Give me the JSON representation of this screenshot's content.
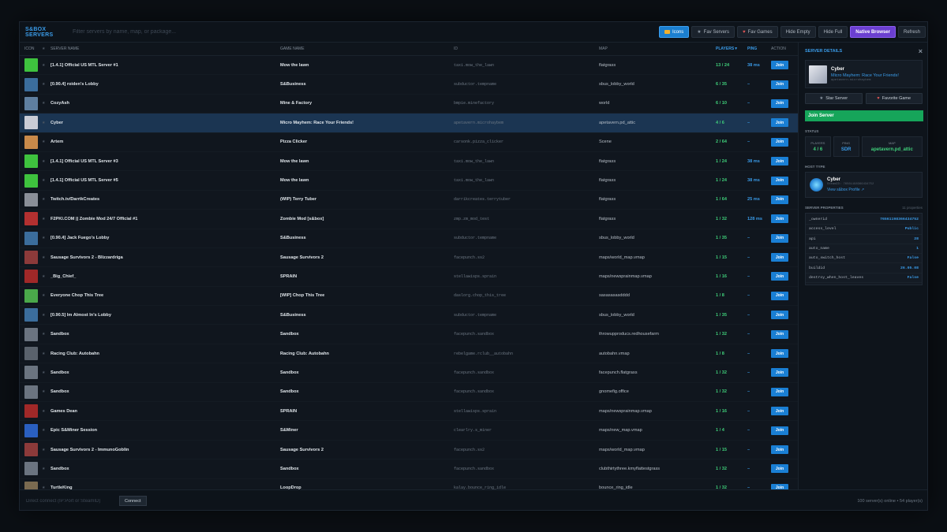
{
  "header": {
    "brand": "S&BOX SERVERS",
    "search_placeholder": "Filter servers by name, map, or package...",
    "buttons": {
      "icons": "Icons",
      "fav_servers": "Fav Servers",
      "fav_games": "Fav Games",
      "hide_empty": "Hide Empty",
      "hide_full": "Hide Full",
      "native_browser": "Native Browser",
      "refresh": "Refresh"
    }
  },
  "table": {
    "columns": {
      "icon": "ICON",
      "fav": "★",
      "server_name": "SERVER NAME",
      "game_name": "GAME NAME",
      "id": "ID",
      "map": "MAP",
      "players": "PLAYERS▼",
      "ping": "PING",
      "action": "ACTION"
    },
    "join_label": "Join",
    "rows": [
      {
        "name": "[1.4.1] Official US MTL Server #1",
        "game": "Mow the lawn",
        "id": "taxi.mow_the_lawn",
        "map": "flatgrass",
        "players": "13 / 24",
        "ping": "38 ms",
        "color": "#3ec23e"
      },
      {
        "name": "[0.90.4] roiden's Lobby",
        "game": "S&Business",
        "id": "subductor.tempname",
        "map": "sbus_lobby_world",
        "players": "6 / 35",
        "ping": "–",
        "color": "#3b6d9c"
      },
      {
        "name": "CozyAsh",
        "game": "Mine & Factory",
        "id": "bmpie.minefactory",
        "map": "world",
        "players": "6 / 10",
        "ping": "–",
        "color": "#5f7fa0"
      },
      {
        "name": "Cyber",
        "game": "Micro Mayhem: Race Your Friends!",
        "id": "apetavern.microhaybem",
        "map": "apetavern.pd_attic",
        "players": "4 / 6",
        "ping": "–",
        "color": "#c9ccd6"
      },
      {
        "name": "Artem",
        "game": "Pizza Clicker",
        "id": "carsonk.pizza_clicker",
        "map": "Scene",
        "players": "2 / 64",
        "ping": "–",
        "color": "#c98a4a"
      },
      {
        "name": "[1.4.1] Official US MTL Server #3",
        "game": "Mow the lawn",
        "id": "taxi.mow_the_lawn",
        "map": "flatgrass",
        "players": "1 / 24",
        "ping": "38 ms",
        "color": "#3ec23e"
      },
      {
        "name": "[1.4.1] Official US MTL Server #5",
        "game": "Mow the lawn",
        "id": "taxi.mow_the_lawn",
        "map": "flatgrass",
        "players": "1 / 24",
        "ping": "38 ms",
        "color": "#3ec23e"
      },
      {
        "name": "Twitch.tv/DarrikCreates",
        "game": "(WIP) Terry Tuber",
        "id": "darrikcreates.terrytuber",
        "map": "flatgrass",
        "players": "1 / 64",
        "ping": "25 ms",
        "color": "#8a8f98"
      },
      {
        "name": "F2PKI.COM || Zombie Mod 24/7 Official #1",
        "game": "Zombie Mod [s&box]",
        "id": "zmp.zm_mod_test",
        "map": "flatgrass",
        "players": "1 / 32",
        "ping": "128 ms",
        "color": "#b33030"
      },
      {
        "name": "[0.90.4] Jack Fuego's Lobby",
        "game": "S&Business",
        "id": "subductor.tempname",
        "map": "sbus_lobby_world",
        "players": "1 / 35",
        "ping": "–",
        "color": "#3b6d9c"
      },
      {
        "name": "Sausage Survivors 2 - Blizzardriga",
        "game": "Sausage Survivors 2",
        "id": "facepunch.ss2",
        "map": "maps/world_map.vmap",
        "players": "1 / 15",
        "ping": "–",
        "color": "#8c3a3a"
      },
      {
        "name": "_Big_Chief_",
        "game": "SPRAIN",
        "id": "stellawisps.sprain",
        "map": "maps/newsprainmap.vmap",
        "players": "1 / 16",
        "ping": "–",
        "color": "#a02828"
      },
      {
        "name": "Everyone Chop This Tree",
        "game": "[WIP] Chop This Tree",
        "id": "daslorg.chop_this_tree",
        "map": "sasasasasdddd",
        "players": "1 / 8",
        "ping": "–",
        "color": "#4aa84a"
      },
      {
        "name": "[0.90.5] Im Almost In's Lobby",
        "game": "S&Business",
        "id": "subductor.tempname",
        "map": "sbus_lobby_world",
        "players": "1 / 35",
        "ping": "–",
        "color": "#3b6d9c"
      },
      {
        "name": "Sandbox",
        "game": "Sandbox",
        "id": "facepunch.sandbox",
        "map": "throwupproducs.redhousefarm",
        "players": "1 / 32",
        "ping": "–",
        "color": "#6b7480"
      },
      {
        "name": "Racing Club: Autobahn",
        "game": "Racing Club: Autobahn",
        "id": "rebelgame.rclub__autobahn",
        "map": "autobahn.vmap",
        "players": "1 / 8",
        "ping": "–",
        "color": "#5a626c"
      },
      {
        "name": "Sandbox",
        "game": "Sandbox",
        "id": "facepunch.sandbox",
        "map": "facepunch.flatgrass",
        "players": "1 / 32",
        "ping": "–",
        "color": "#6b7480"
      },
      {
        "name": "Sandbox",
        "game": "Sandbox",
        "id": "facepunch.sandbox",
        "map": "gnomefig.office",
        "players": "1 / 32",
        "ping": "–",
        "color": "#6b7480"
      },
      {
        "name": "Games Dean",
        "game": "SPRAIN",
        "id": "stellawisps.sprain",
        "map": "maps/newsprainmap.vmap",
        "players": "1 / 16",
        "ping": "–",
        "color": "#a02828"
      },
      {
        "name": "Epic S&Miner Session",
        "game": "S&Miner",
        "id": "clearlry.s_miner",
        "map": "maps/new_map.vmap",
        "players": "1 / 4",
        "ping": "–",
        "color": "#2a5fc0"
      },
      {
        "name": "Sausage Survivors 2 - ImmunoGoblin",
        "game": "Sausage Survivors 2",
        "id": "facepunch.ss2",
        "map": "maps/world_map.vmap",
        "players": "1 / 15",
        "ping": "–",
        "color": "#8c3a3a"
      },
      {
        "name": "Sandbox",
        "game": "Sandbox",
        "id": "facepunch.sandbox",
        "map": "clubthirtythree.kmyflattestgrass",
        "players": "1 / 32",
        "ping": "–",
        "color": "#6b7480"
      },
      {
        "name": "TurtleKing",
        "game": "LoopDrop",
        "id": "kalay.bounce_ring_idle",
        "map": "bounce_ring_idle",
        "players": "1 / 32",
        "ping": "–",
        "color": "#7a6a50"
      }
    ]
  },
  "details": {
    "title": "SERVER DETAILS",
    "server_name": "Cyber",
    "game_name": "Micro Mayhem: Race Your Friends!",
    "game_id": "apetavern.microhaybem",
    "star_label": "Star Server",
    "fav_label": "Favorite Game",
    "join_label": "Join Server",
    "status_label": "STATUS",
    "players_label": "PLAYERS",
    "players_value": "4 / 6",
    "ping_label": "PING",
    "ping_value": "SDR",
    "map_label": "MAP",
    "map_value": "apetavern.pd_attic",
    "host_label": "HOST TYPE",
    "host_name": "Cyber",
    "host_steamid": "SteamID: 76561198366434752",
    "host_link": "View s&box Profile ↗",
    "props_label": "SERVER PROPERTIES",
    "props_count": "11 properties",
    "properties": [
      {
        "k": "_ownerid",
        "v": "76561198366434752"
      },
      {
        "k": "access_level",
        "v": "Public"
      },
      {
        "k": "api",
        "v": "28"
      },
      {
        "k": "auto_name",
        "v": "1"
      },
      {
        "k": "auto_switch_host",
        "v": "False"
      },
      {
        "k": "buildid",
        "v": "26.05.08"
      },
      {
        "k": "destroy_when_host_leaves",
        "v": "False"
      }
    ]
  },
  "footer": {
    "connect_placeholder": "Direct connect (IP:Port or SteamID)",
    "connect_label": "Connect",
    "status": "100 server(s) online • 54 player(s)"
  }
}
